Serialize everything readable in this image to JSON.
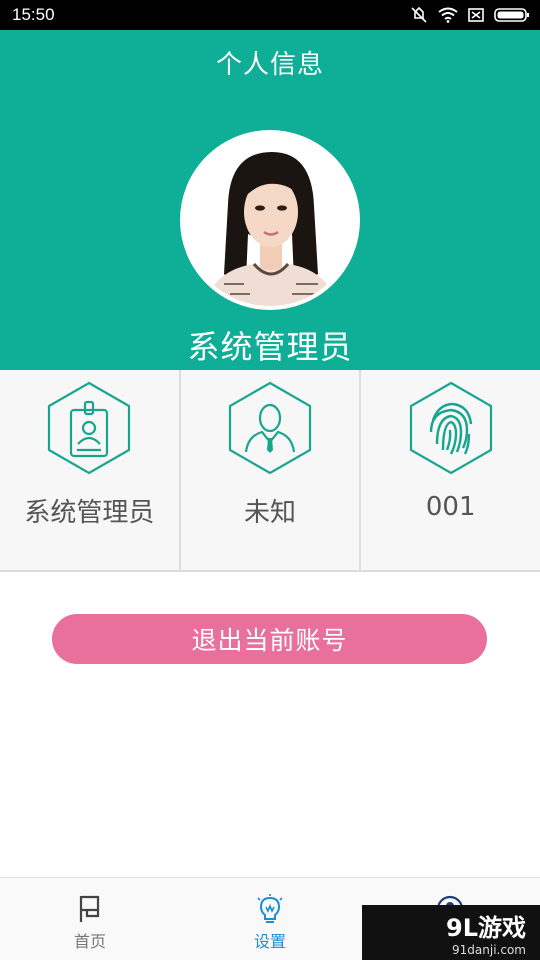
{
  "status_bar": {
    "time": "15:50",
    "icons": [
      "mute-icon",
      "wifi-icon",
      "sim-icon",
      "battery-icon"
    ]
  },
  "header": {
    "title": "个人信息",
    "user_name": "系统管理员",
    "background_color": "#0fae97"
  },
  "info_cells": [
    {
      "icon": "id-badge-icon",
      "label": "系统管理员"
    },
    {
      "icon": "person-icon",
      "label": "未知"
    },
    {
      "icon": "fingerprint-icon",
      "label": "001"
    }
  ],
  "logout": {
    "label": "退出当前账号",
    "color": "#e8709b"
  },
  "bottom_nav": [
    {
      "icon": "flag-icon",
      "label": "首页",
      "active": false
    },
    {
      "icon": "lightbulb-icon",
      "label": "设置",
      "active": true
    },
    {
      "icon": "profile-icon",
      "label": "",
      "active": false
    }
  ],
  "watermark": {
    "main": "9L游戏",
    "sub": "91danji.com"
  }
}
